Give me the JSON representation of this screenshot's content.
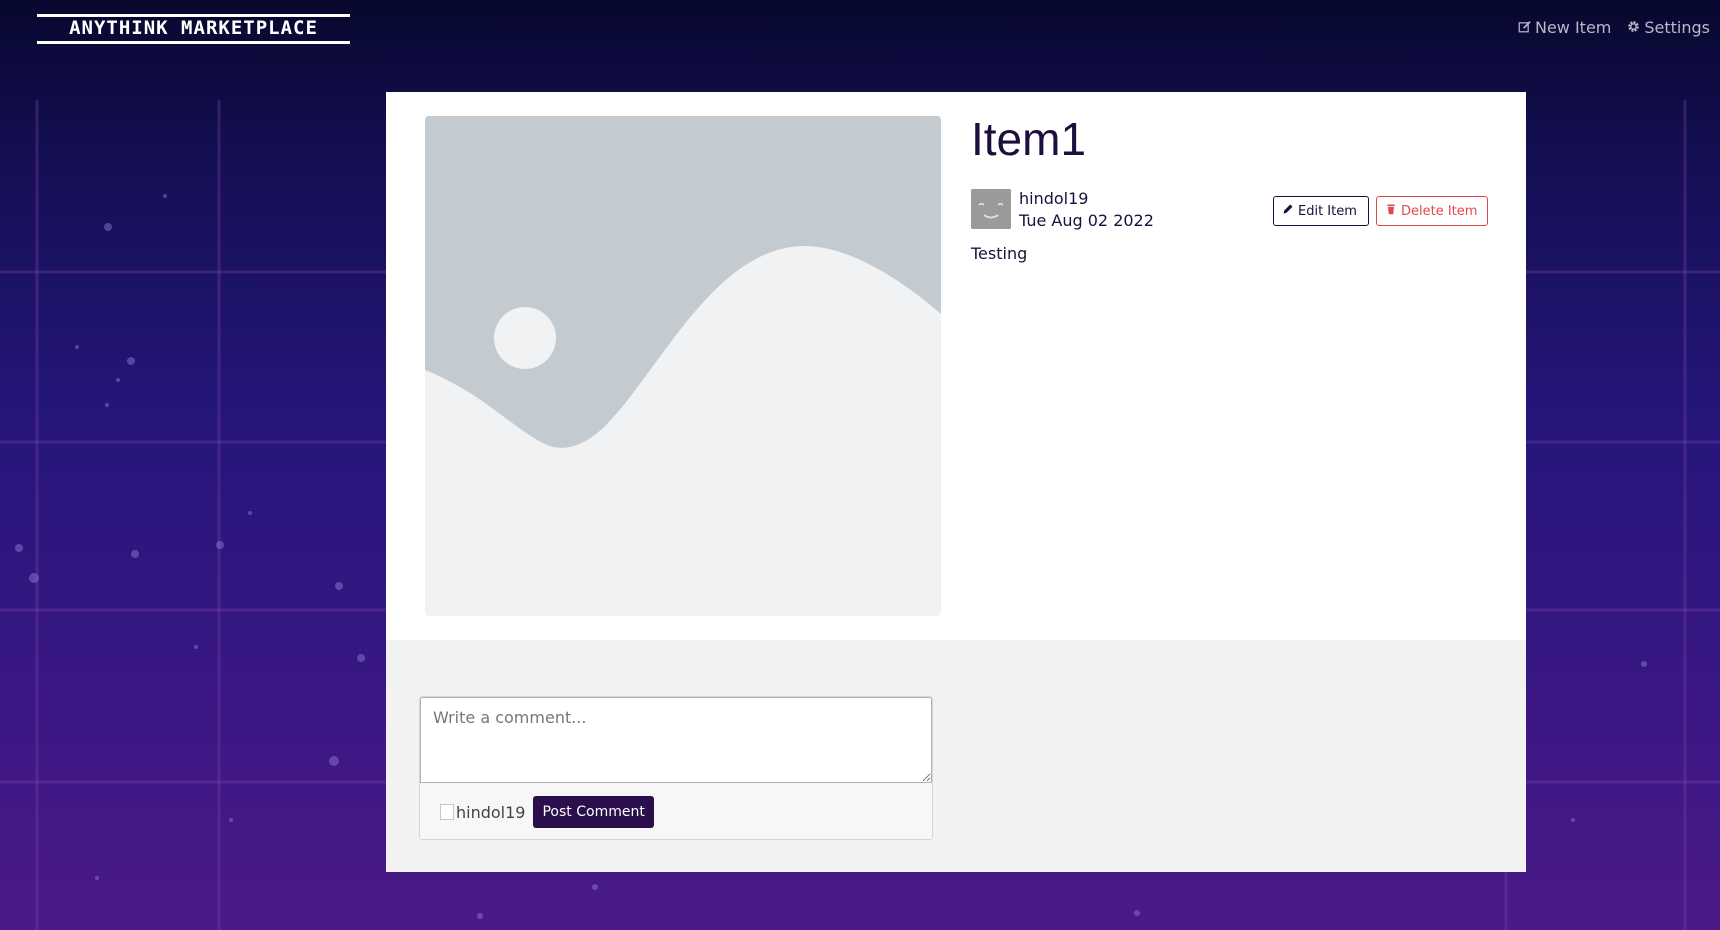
{
  "navbar": {
    "brand": "ANYTHINK MARKETPLACE",
    "links": [
      {
        "label": "New Item",
        "icon": "edit-icon"
      },
      {
        "label": "Settings",
        "icon": "gear-icon"
      }
    ]
  },
  "item": {
    "title": "Item1",
    "image_icon": "image-placeholder-icon",
    "seller": {
      "username": "hindol19",
      "avatar_icon": "smiley-avatar-icon"
    },
    "date": "Tue Aug 02 2022",
    "description": "Testing",
    "edit_label": "Edit Item",
    "delete_label": "Delete Item"
  },
  "comments": {
    "placeholder": "Write a comment...",
    "value": "",
    "avatar_alt": "hindol19",
    "post_label": "Post Comment"
  },
  "colors": {
    "primary": "#1c0f3d",
    "danger": "#e04a4a",
    "post_button": "#2b0f4d",
    "background_top": "#07082e",
    "background_bottom": "#4a1a86"
  }
}
